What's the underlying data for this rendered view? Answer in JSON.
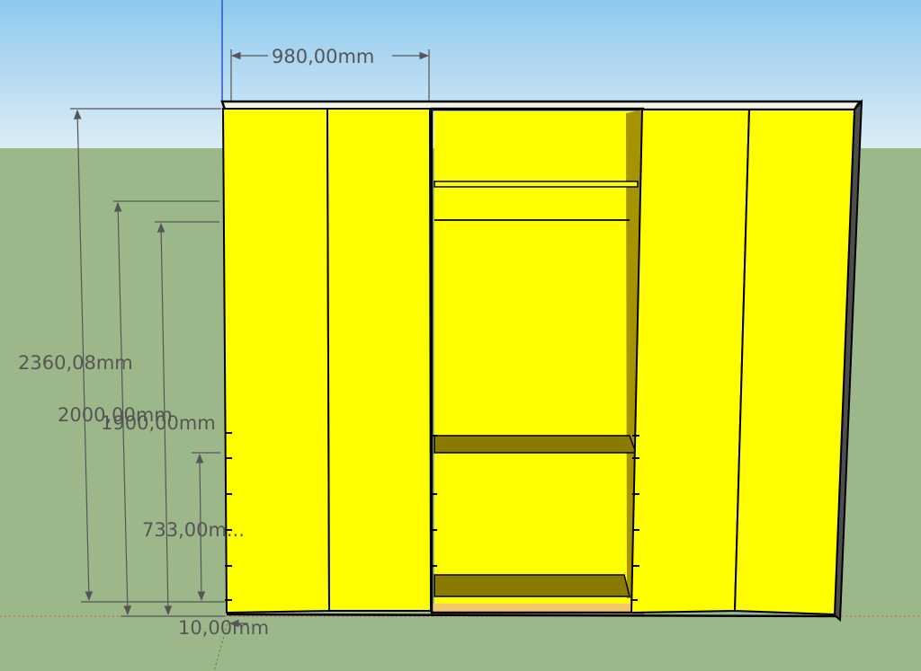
{
  "colors": {
    "sky_top": "#8ec9ee",
    "sky_bottom": "#dcecf6",
    "ground": "#9cb88b",
    "panel": "#ffff00",
    "panel_shadow": "#e9e900",
    "interior_floor": "#8a7a00",
    "edge": "#000000",
    "dimension": "#555555"
  },
  "dimensions": {
    "width_top": "980,00mm",
    "total_height": "2360,08mm",
    "height_2000": "2000,00mm",
    "height_1900": "1900,00mm",
    "height_733": "733,00m...",
    "bottom_offset": "10,00mm"
  }
}
